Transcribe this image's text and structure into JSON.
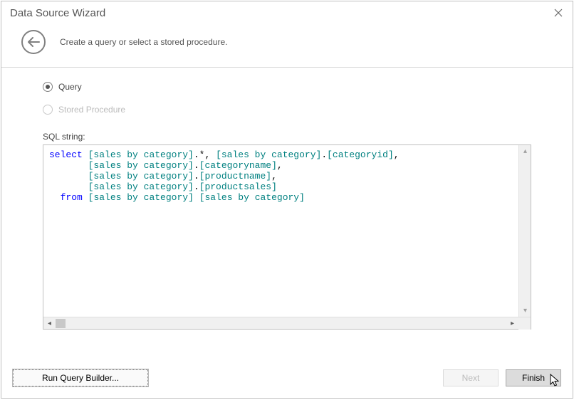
{
  "window": {
    "title": "Data Source Wizard"
  },
  "banner": {
    "subtitle": "Create a query or select a stored procedure."
  },
  "options": {
    "query_label": "Query",
    "stored_procedure_label": "Stored Procedure",
    "selected": "query"
  },
  "sql": {
    "label": "SQL string:",
    "tokens": [
      [
        {
          "t": "select",
          "c": "kw-blue"
        },
        {
          "t": " "
        },
        {
          "t": "[sales by category]",
          "c": "id-teal"
        },
        {
          "t": ".*, "
        },
        {
          "t": "[sales by category]",
          "c": "id-teal"
        },
        {
          "t": "."
        },
        {
          "t": "[categoryid]",
          "c": "id-teal"
        },
        {
          "t": ","
        }
      ],
      [
        {
          "t": "       "
        },
        {
          "t": "[sales by category]",
          "c": "id-teal"
        },
        {
          "t": "."
        },
        {
          "t": "[categoryname]",
          "c": "id-teal"
        },
        {
          "t": ","
        }
      ],
      [
        {
          "t": "       "
        },
        {
          "t": "[sales by category]",
          "c": "id-teal"
        },
        {
          "t": "."
        },
        {
          "t": "[productname]",
          "c": "id-teal"
        },
        {
          "t": ","
        }
      ],
      [
        {
          "t": "       "
        },
        {
          "t": "[sales by category]",
          "c": "id-teal"
        },
        {
          "t": "."
        },
        {
          "t": "[productsales]",
          "c": "id-teal"
        }
      ],
      [
        {
          "t": "  "
        },
        {
          "t": "from",
          "c": "kw-blue"
        },
        {
          "t": " "
        },
        {
          "t": "[sales by category]",
          "c": "id-teal"
        },
        {
          "t": " "
        },
        {
          "t": "[sales by category]",
          "c": "id-teal"
        }
      ]
    ]
  },
  "buttons": {
    "run_query_builder": "Run Query Builder...",
    "next": "Next",
    "finish": "Finish"
  }
}
